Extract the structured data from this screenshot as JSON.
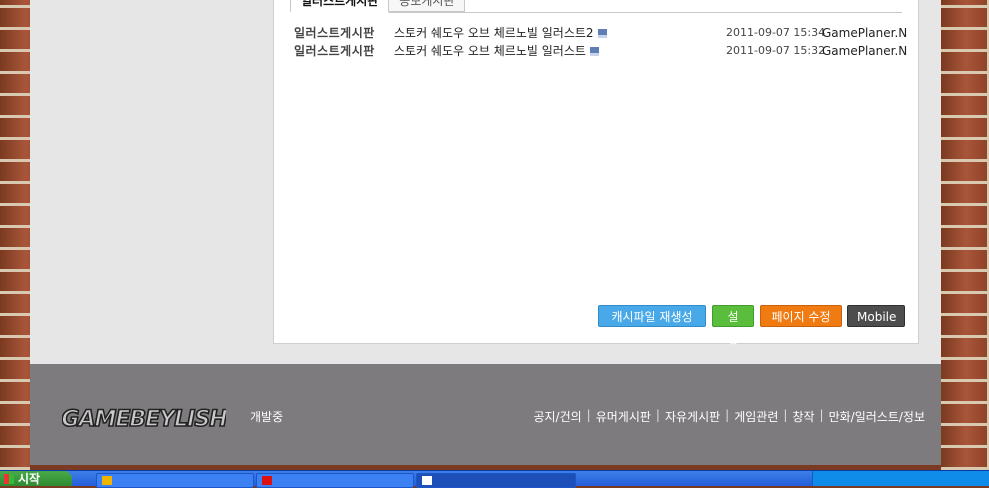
{
  "tabs": [
    {
      "label": "일러스트게시판",
      "active": true
    },
    {
      "label": "공모게시판",
      "active": false
    }
  ],
  "posts": [
    {
      "board": "일러스트게시판",
      "title": "스토커 쉐도우 오브 체르노빌 일러스트2",
      "date": "2011-09-07 15:34",
      "author": "GamePlaner.N",
      "icon": "save-disk-icon"
    },
    {
      "board": "일러스트게시판",
      "title": "스토커 쉐도우 오브 체르노빌 일러스트",
      "date": "2011-09-07 15:32",
      "author": "GamePlaner.N",
      "icon": "save-disk-icon"
    }
  ],
  "buttons": {
    "cache": "캐시파일 재생성",
    "setting": "설정",
    "edit_page": "페이지 수정",
    "mobile": "Mobile"
  },
  "colors": {
    "cache": "#49a9e8",
    "setting": "#5bbd3c",
    "edit_page": "#f07b12",
    "mobile": "#4d4d4d",
    "footer": "#7e7b7e"
  },
  "footer": {
    "logo_text": "GAMEBEYLISH",
    "dev_status": "개발중",
    "links": [
      "공지/건의",
      "유머게시판",
      "자유게시판",
      "게임관련",
      "창작",
      "만화/일러스트/정보"
    ]
  },
  "taskbar": {
    "start_label": "시작"
  }
}
